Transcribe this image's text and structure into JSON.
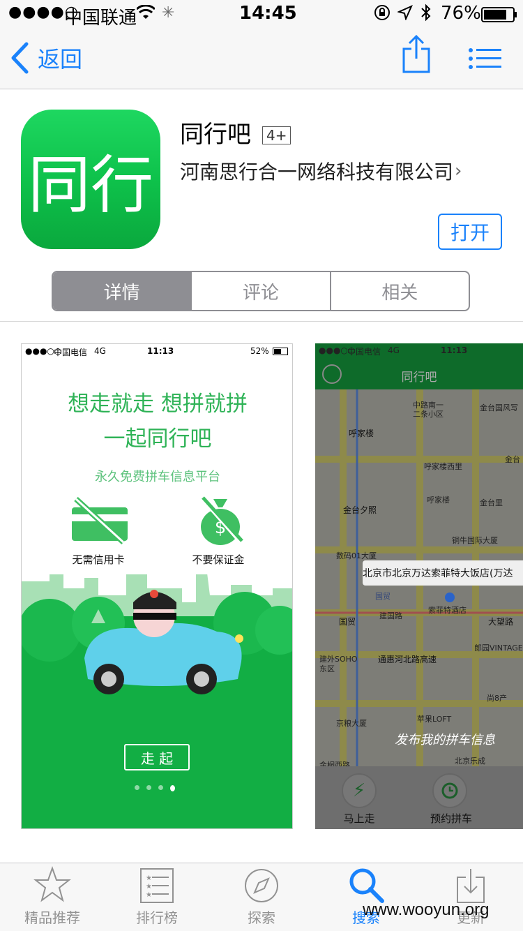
{
  "status_bar": {
    "signal": "●●●●○",
    "carrier": "中国联通",
    "time": "14:45",
    "battery_pct": "76%"
  },
  "nav": {
    "back_label": "返回"
  },
  "app": {
    "name": "同行吧",
    "age_rating": "4+",
    "developer": "河南思行合一网络科技有限公司",
    "open_label": "打开",
    "icon_text": "同行"
  },
  "segments": [
    "详情",
    "评论",
    "相关"
  ],
  "shot1": {
    "signal": "●●●○○",
    "carrier": "中国电信",
    "net": "4G",
    "time": "11:13",
    "battery": "52%",
    "headline1": "想走就走 想拼就拼",
    "headline2": "一起同行吧",
    "tagline": "永久免费拼车信息平台",
    "feature1": "无需信用卡",
    "feature2": "不要保证金",
    "go_label": "走 起"
  },
  "shot2": {
    "signal": "●●●○○",
    "carrier": "中国电信",
    "net": "4G",
    "time": "11:13",
    "title": "同行吧",
    "callout": "北京市北京万达索菲特大饭店(万达",
    "handwriting": "发布我的拼车信息",
    "btn1": "马上走",
    "btn2": "预约拼车",
    "map_labels": [
      "中路南一",
      "二条小区",
      "金台国风写",
      "呼家楼",
      "呼家楼西里",
      "金台",
      "金台夕照",
      "呼家楼",
      "金台里",
      "铜牛国际大厦",
      "数码01大厦",
      "国贸",
      "国贸",
      "建国路",
      "索菲特酒店",
      "大望路",
      "建外SOHO",
      "东区",
      "通惠河北路高速",
      "郎园VINTAGE",
      "尚8产",
      "京粮大厦",
      "苹果LOFT",
      "北京乐成",
      "金桐西路"
    ]
  },
  "tabbar": {
    "tabs": [
      {
        "label": "精品推荐",
        "icon": "star-icon"
      },
      {
        "label": "排行榜",
        "icon": "list-icon"
      },
      {
        "label": "探索",
        "icon": "compass-icon"
      },
      {
        "label": "搜索",
        "icon": "search-icon"
      },
      {
        "label": "更新",
        "icon": "download-icon"
      }
    ]
  },
  "watermark": "www.wooyun.org",
  "colors": {
    "accent": "#1a82fb",
    "green": "#10b14a",
    "segment": "#8e8e93"
  }
}
